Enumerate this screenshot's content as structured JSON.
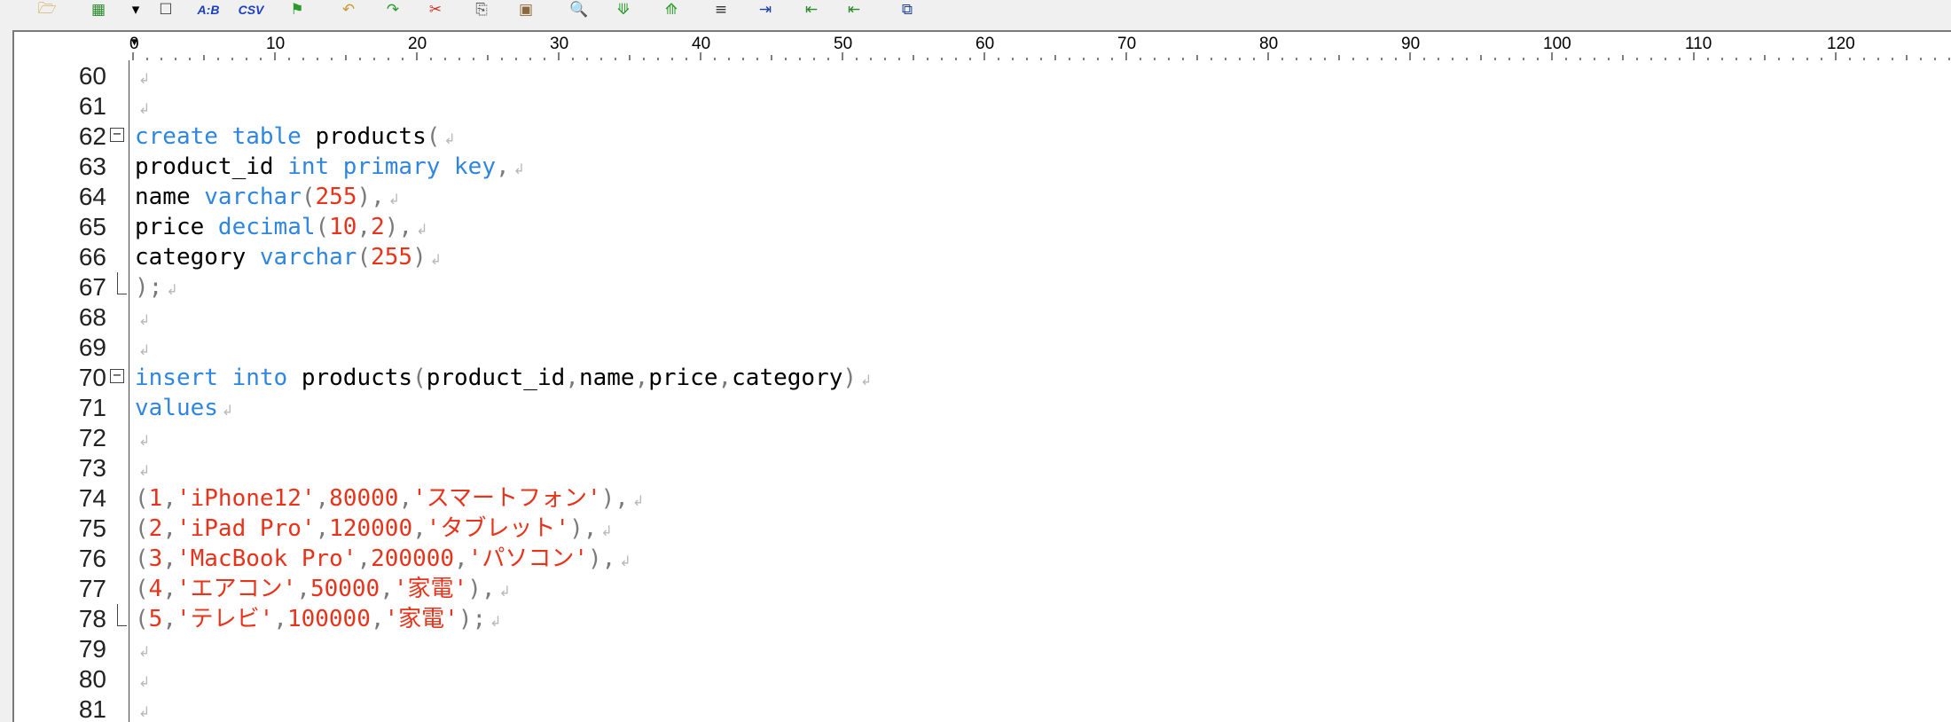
{
  "colors": {
    "keyword": "#2f86e0",
    "string": "#e8321a",
    "number": "#e8321a",
    "punctuation": "#7a7a7a",
    "default": "#000000",
    "eol_mark": "#b8b8b8"
  },
  "toolbar": {
    "icons": [
      {
        "name": "open-folder-icon",
        "glyph": "🗁",
        "color": "#c89a2a"
      },
      {
        "name": "new-file-dropdown-icon",
        "glyph": "▦",
        "color": "#2a8a2a"
      },
      {
        "name": "dropdown-arrow-icon",
        "glyph": "▾",
        "color": "#000000"
      },
      {
        "name": "blank-document-icon",
        "glyph": "☐",
        "color": "#444444"
      },
      {
        "name": "ab-compare-icon",
        "text": "A:B",
        "color": "#1a3fbf"
      },
      {
        "name": "csv-icon",
        "text": "CSV",
        "color": "#1a3fbf"
      },
      {
        "name": "search-flag-icon",
        "glyph": "⚑",
        "color": "#2a9a2a"
      },
      {
        "name": "undo-icon",
        "glyph": "↶",
        "color": "#c89a2a"
      },
      {
        "name": "redo-icon",
        "glyph": "↷",
        "color": "#2a9a2a"
      },
      {
        "name": "cut-icon",
        "glyph": "✂",
        "color": "#d03020"
      },
      {
        "name": "copy-icon",
        "glyph": "⎘",
        "color": "#555555"
      },
      {
        "name": "paste-icon",
        "glyph": "▣",
        "color": "#8a6a3a"
      },
      {
        "name": "find-icon",
        "glyph": "🔍",
        "color": "#3060c0"
      },
      {
        "name": "find-next-icon",
        "glyph": "⟱",
        "color": "#2a9a2a"
      },
      {
        "name": "find-prev-icon",
        "glyph": "⟰",
        "color": "#2a9a2a"
      },
      {
        "name": "align-icon",
        "glyph": "≡",
        "color": "#333333"
      },
      {
        "name": "indent-icon",
        "glyph": "⇥",
        "color": "#2040a0"
      },
      {
        "name": "outdent-left-icon",
        "glyph": "⇤",
        "color": "#2a8a2a"
      },
      {
        "name": "outdent-icon",
        "glyph": "⇤",
        "color": "#2a8a2a"
      },
      {
        "name": "window-split-icon",
        "glyph": "⧉",
        "color": "#2040a0"
      }
    ]
  },
  "ruler": {
    "labels": [
      "0",
      "10",
      "20",
      "30",
      "40",
      "50",
      "60",
      "70",
      "80",
      "90",
      "100",
      "110",
      "120"
    ]
  },
  "editor": {
    "lines": [
      {
        "num": "60",
        "tokens": []
      },
      {
        "num": "61",
        "tokens": []
      },
      {
        "num": "62",
        "fold": "start",
        "tokens": [
          {
            "t": "create table",
            "c": "keyword"
          },
          {
            "t": " products",
            "c": "default"
          },
          {
            "t": "(",
            "c": "punct"
          }
        ]
      },
      {
        "num": "63",
        "fold": "mid",
        "tokens": [
          {
            "t": "product_id ",
            "c": "default"
          },
          {
            "t": "int primary key",
            "c": "keyword"
          },
          {
            "t": ",",
            "c": "punct"
          }
        ]
      },
      {
        "num": "64",
        "fold": "mid",
        "tokens": [
          {
            "t": "name ",
            "c": "default"
          },
          {
            "t": "varchar",
            "c": "keyword"
          },
          {
            "t": "(",
            "c": "punct"
          },
          {
            "t": "255",
            "c": "number"
          },
          {
            "t": "),",
            "c": "punct"
          }
        ]
      },
      {
        "num": "65",
        "fold": "mid",
        "tokens": [
          {
            "t": "price ",
            "c": "default"
          },
          {
            "t": "decimal",
            "c": "keyword"
          },
          {
            "t": "(",
            "c": "punct"
          },
          {
            "t": "10",
            "c": "number"
          },
          {
            "t": ",",
            "c": "punct"
          },
          {
            "t": "2",
            "c": "number"
          },
          {
            "t": "),",
            "c": "punct"
          }
        ]
      },
      {
        "num": "66",
        "fold": "mid",
        "tokens": [
          {
            "t": "category ",
            "c": "default"
          },
          {
            "t": "varchar",
            "c": "keyword"
          },
          {
            "t": "(",
            "c": "punct"
          },
          {
            "t": "255",
            "c": "number"
          },
          {
            "t": ")",
            "c": "punct"
          }
        ]
      },
      {
        "num": "67",
        "fold": "end",
        "tokens": [
          {
            "t": ");",
            "c": "punct"
          }
        ]
      },
      {
        "num": "68",
        "tokens": []
      },
      {
        "num": "69",
        "tokens": []
      },
      {
        "num": "70",
        "fold": "start",
        "tokens": [
          {
            "t": "insert into",
            "c": "keyword"
          },
          {
            "t": " products",
            "c": "default"
          },
          {
            "t": "(",
            "c": "punct"
          },
          {
            "t": "product_id",
            "c": "default"
          },
          {
            "t": ",",
            "c": "punct"
          },
          {
            "t": "name",
            "c": "default"
          },
          {
            "t": ",",
            "c": "punct"
          },
          {
            "t": "price",
            "c": "default"
          },
          {
            "t": ",",
            "c": "punct"
          },
          {
            "t": "category",
            "c": "default"
          },
          {
            "t": ")",
            "c": "punct"
          }
        ]
      },
      {
        "num": "71",
        "fold": "mid",
        "tokens": [
          {
            "t": "values",
            "c": "keyword"
          }
        ]
      },
      {
        "num": "72",
        "fold": "mid",
        "tokens": []
      },
      {
        "num": "73",
        "fold": "mid",
        "tokens": []
      },
      {
        "num": "74",
        "fold": "mid",
        "tokens": [
          {
            "t": "(",
            "c": "punct"
          },
          {
            "t": "1",
            "c": "number"
          },
          {
            "t": ",",
            "c": "punct"
          },
          {
            "t": "'iPhone12'",
            "c": "string"
          },
          {
            "t": ",",
            "c": "punct"
          },
          {
            "t": "80000",
            "c": "number"
          },
          {
            "t": ",",
            "c": "punct"
          },
          {
            "t": "'スマートフォン'",
            "c": "string"
          },
          {
            "t": "),",
            "c": "punct"
          }
        ]
      },
      {
        "num": "75",
        "fold": "mid",
        "tokens": [
          {
            "t": "(",
            "c": "punct"
          },
          {
            "t": "2",
            "c": "number"
          },
          {
            "t": ",",
            "c": "punct"
          },
          {
            "t": "'iPad Pro'",
            "c": "string"
          },
          {
            "t": ",",
            "c": "punct"
          },
          {
            "t": "120000",
            "c": "number"
          },
          {
            "t": ",",
            "c": "punct"
          },
          {
            "t": "'タブレット'",
            "c": "string"
          },
          {
            "t": "),",
            "c": "punct"
          }
        ]
      },
      {
        "num": "76",
        "fold": "mid",
        "tokens": [
          {
            "t": "(",
            "c": "punct"
          },
          {
            "t": "3",
            "c": "number"
          },
          {
            "t": ",",
            "c": "punct"
          },
          {
            "t": "'MacBook Pro'",
            "c": "string"
          },
          {
            "t": ",",
            "c": "punct"
          },
          {
            "t": "200000",
            "c": "number"
          },
          {
            "t": ",",
            "c": "punct"
          },
          {
            "t": "'パソコン'",
            "c": "string"
          },
          {
            "t": "),",
            "c": "punct"
          }
        ]
      },
      {
        "num": "77",
        "fold": "mid",
        "tokens": [
          {
            "t": "(",
            "c": "punct"
          },
          {
            "t": "4",
            "c": "number"
          },
          {
            "t": ",",
            "c": "punct"
          },
          {
            "t": "'エアコン'",
            "c": "string"
          },
          {
            "t": ",",
            "c": "punct"
          },
          {
            "t": "50000",
            "c": "number"
          },
          {
            "t": ",",
            "c": "punct"
          },
          {
            "t": "'家電'",
            "c": "string"
          },
          {
            "t": "),",
            "c": "punct"
          }
        ]
      },
      {
        "num": "78",
        "fold": "end",
        "tokens": [
          {
            "t": "(",
            "c": "punct"
          },
          {
            "t": "5",
            "c": "number"
          },
          {
            "t": ",",
            "c": "punct"
          },
          {
            "t": "'テレビ'",
            "c": "string"
          },
          {
            "t": ",",
            "c": "punct"
          },
          {
            "t": "100000",
            "c": "number"
          },
          {
            "t": ",",
            "c": "punct"
          },
          {
            "t": "'家電'",
            "c": "string"
          },
          {
            "t": ");",
            "c": "punct"
          }
        ]
      },
      {
        "num": "79",
        "tokens": []
      },
      {
        "num": "80",
        "tokens": []
      },
      {
        "num": "81",
        "tokens": []
      }
    ],
    "eol_glyph": "↲",
    "fold_glyph": "⊟"
  }
}
